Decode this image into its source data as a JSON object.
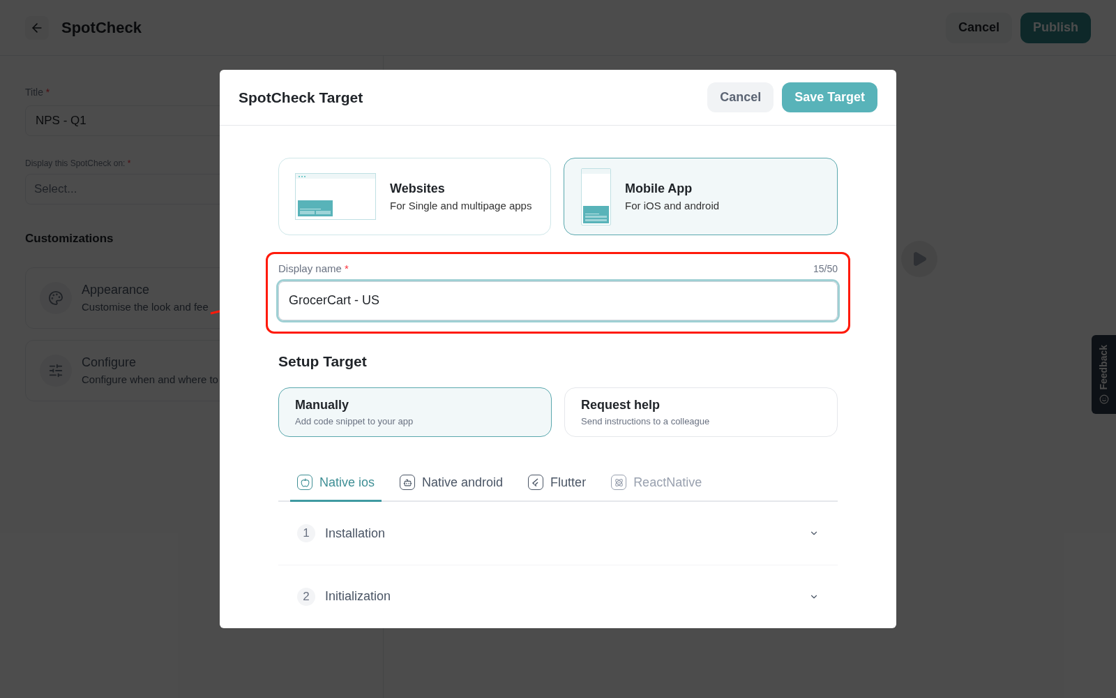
{
  "header": {
    "title": "SpotCheck",
    "buttons": [
      {
        "label": "Cancel",
        "kind": "secondary"
      },
      {
        "label": "Publish",
        "kind": "primary"
      }
    ]
  },
  "form": {
    "title_field": {
      "label": "Title",
      "required_mark": "*",
      "value": "NPS - Q1"
    },
    "display_field": {
      "label": "Display this SpotCheck on:",
      "required_mark": "*",
      "placeholder": "Select..."
    },
    "customizations": {
      "heading": "Customizations",
      "items": [
        {
          "kind": "appearance",
          "title": "Appearance",
          "description": "Customise the look and fee"
        },
        {
          "kind": "configure",
          "title": "Configure",
          "description": "Configure when and where to"
        }
      ]
    }
  },
  "feedback_tab": {
    "label": "Feedback"
  },
  "modal": {
    "title": "SpotCheck Target",
    "buttons": [
      {
        "label": "Cancel",
        "kind": "secondary"
      },
      {
        "label": "Save Target",
        "kind": "primary"
      }
    ],
    "platforms": [
      {
        "kind": "website",
        "title": "Websites",
        "description": "For Single and multipage apps",
        "selected": false
      },
      {
        "kind": "mobile",
        "title": "Mobile App",
        "description": "For iOS and android",
        "selected": true
      }
    ],
    "display_name": {
      "label": "Display name",
      "required_mark": "*",
      "counter": "15/50",
      "value": "GrocerCart - US"
    },
    "setup": {
      "heading": "Setup Target",
      "options": [
        {
          "title": "Manually",
          "description": "Add code snippet to your app",
          "selected": true
        },
        {
          "title": "Request help",
          "description": "Send instructions to a colleague",
          "selected": false
        }
      ],
      "tabs": [
        {
          "kind": "ios",
          "label": "Native ios",
          "selected": true,
          "disabled": false
        },
        {
          "kind": "android",
          "label": "Native android",
          "selected": false,
          "disabled": false
        },
        {
          "kind": "flutter",
          "label": "Flutter",
          "selected": false,
          "disabled": false
        },
        {
          "kind": "react",
          "label": "ReactNative",
          "selected": false,
          "disabled": true
        }
      ],
      "steps": [
        {
          "number": "1",
          "title": "Installation",
          "expanded": false
        },
        {
          "number": "2",
          "title": "Initialization",
          "expanded": false
        }
      ]
    }
  }
}
